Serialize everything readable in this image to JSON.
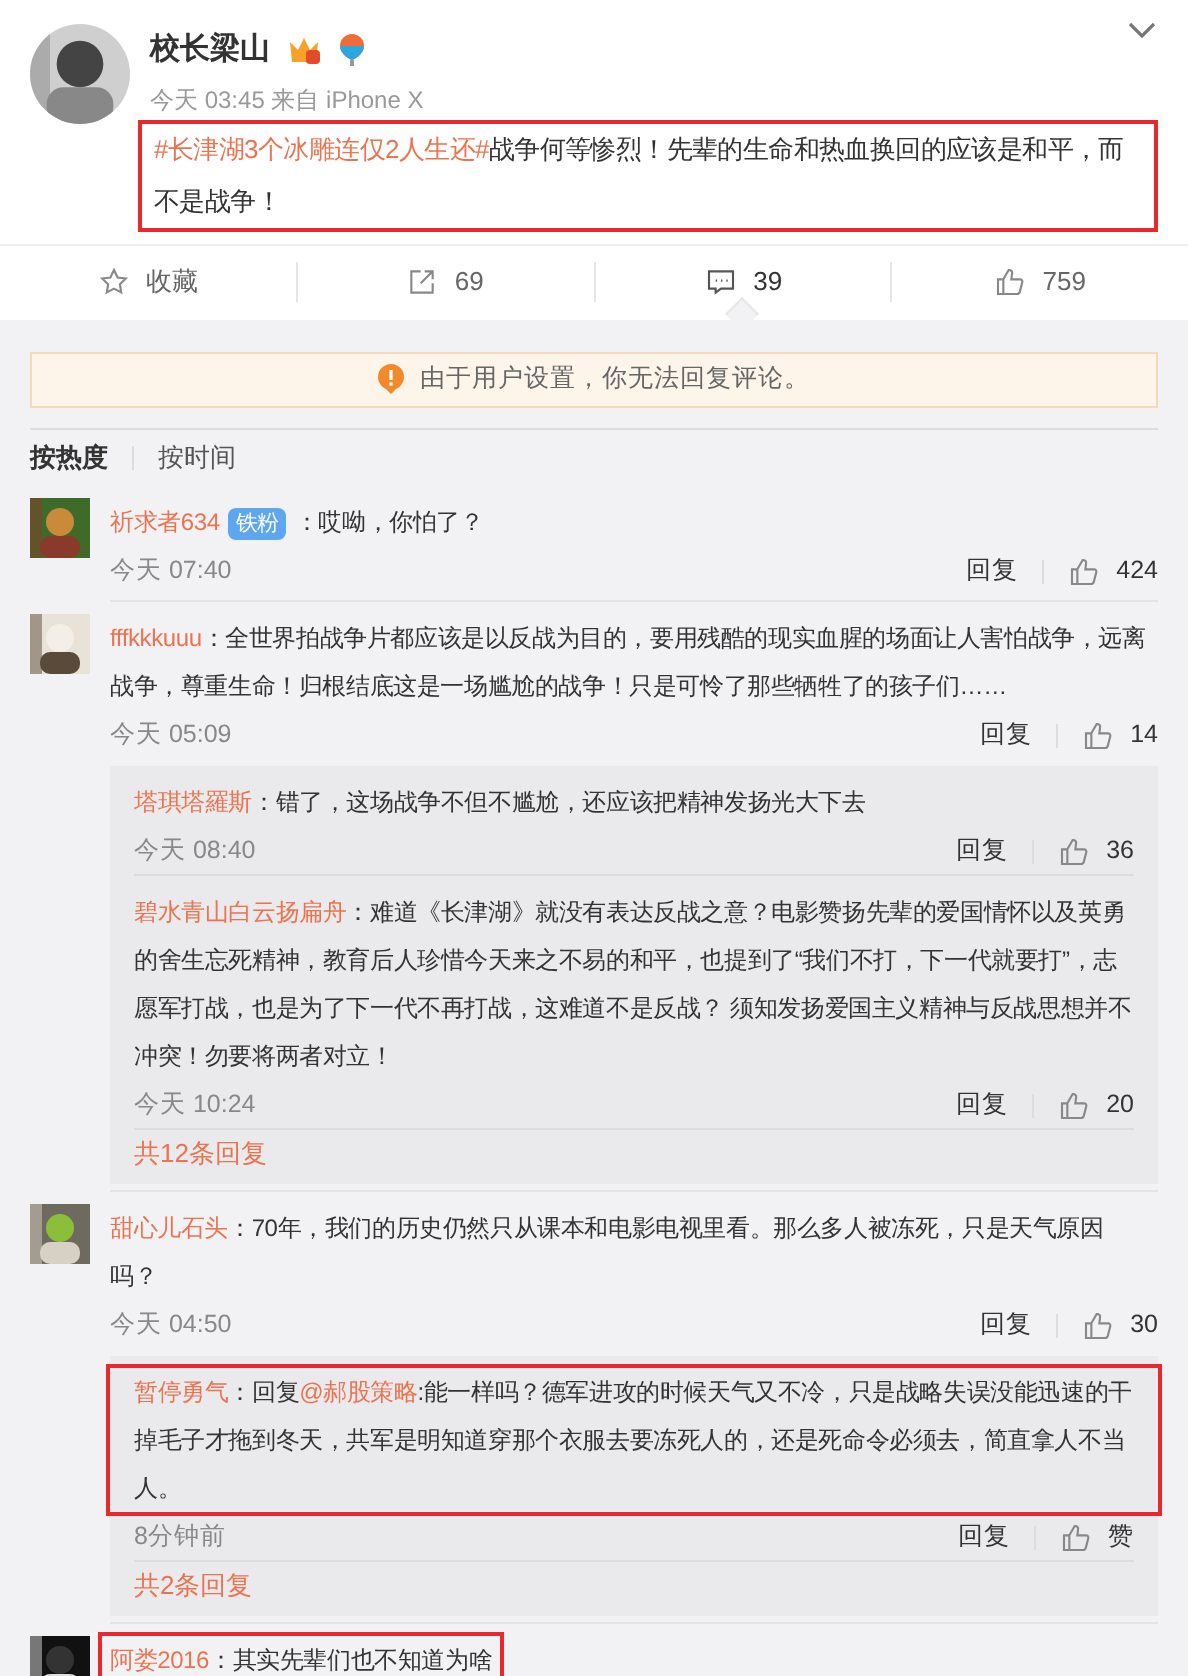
{
  "post": {
    "author": "校长梁山",
    "meta": "今天 03:45 来自 iPhone X",
    "topic": "#长津湖3个冰雕连仅2人生还#",
    "text": "战争何等惨烈！先辈的生命和热血换回的应该是和平，而不是战争！",
    "highlighted": true
  },
  "actions": [
    {
      "kind": "favorite",
      "label": "收藏",
      "selected": false
    },
    {
      "kind": "repost",
      "label": "69",
      "selected": false
    },
    {
      "kind": "comment",
      "label": "39",
      "selected": true
    },
    {
      "kind": "like",
      "label": "759",
      "selected": false
    }
  ],
  "notice": "由于用户设置，你无法回复评论。",
  "sort_tabs": [
    {
      "label": "按热度",
      "selected": true
    },
    {
      "label": "按时间",
      "selected": false
    }
  ],
  "comments": [
    {
      "user": "祈求者634",
      "badge": "铁粉",
      "text": "：哎呦，你怕了？",
      "time": "今天 07:40",
      "reply": "回复",
      "likes": "424",
      "highlighted": false
    },
    {
      "user": "fffkkkuuu",
      "text": "：全世界拍战争片都应该是以反战为目的，要用残酷的现实血腥的场面让人害怕战争，远离战争，尊重生命！归根结底这是一场尴尬的战争！只是可怜了那些牺牲了的孩子们……",
      "time": "今天 05:09",
      "reply": "回复",
      "likes": "14",
      "highlighted": false,
      "replies": [
        {
          "user": "塔琪塔羅斯",
          "text": "：错了，这场战争不但不尴尬，还应该把精神发扬光大下去",
          "time": "今天 08:40",
          "reply": "回复",
          "likes": "36",
          "highlighted": false
        },
        {
          "user": "碧水青山白云扬扁舟",
          "text": "：难道《长津湖》就没有表达反战之意？电影赞扬先辈的爱国情怀以及英勇的舍生忘死精神，教育后人珍惜今天来之不易的和平，也提到了“我们不打，下一代就要打”，志愿军打战，也是为了下一代不再打战，这难道不是反战？ 须知发扬爱国主义精神与反战思想并不冲突！勿要将两者对立！",
          "time": "今天 10:24",
          "reply": "回复",
          "likes": "20",
          "highlighted": false
        }
      ],
      "more_replies": "共12条回复"
    },
    {
      "user": "甜心儿石头",
      "text": "：70年，我们的历史仍然只从课本和电影电视里看。那么多人被冻死，只是天气原因吗？",
      "time": "今天 04:50",
      "reply": "回复",
      "likes": "30",
      "highlighted": false,
      "replies": [
        {
          "user": "暂停勇气",
          "prefix": "：回复",
          "mention": "@郝股策略",
          "text": ":能一样吗？德军进攻的时候天气又不冷，只是战略失误没能迅速的干掉毛子才拖到冬天，共军是明知道穿那个衣服去要冻死人的，还是死命令必须去，简直拿人不当人。",
          "time": "8分钟前",
          "reply": "回复",
          "likes": "赞",
          "highlighted": true
        }
      ],
      "more_replies": "共2条回复"
    },
    {
      "user": "阿娄2016",
      "text": "：其实先辈们也不知道为啥",
      "highlighted": true
    }
  ]
}
